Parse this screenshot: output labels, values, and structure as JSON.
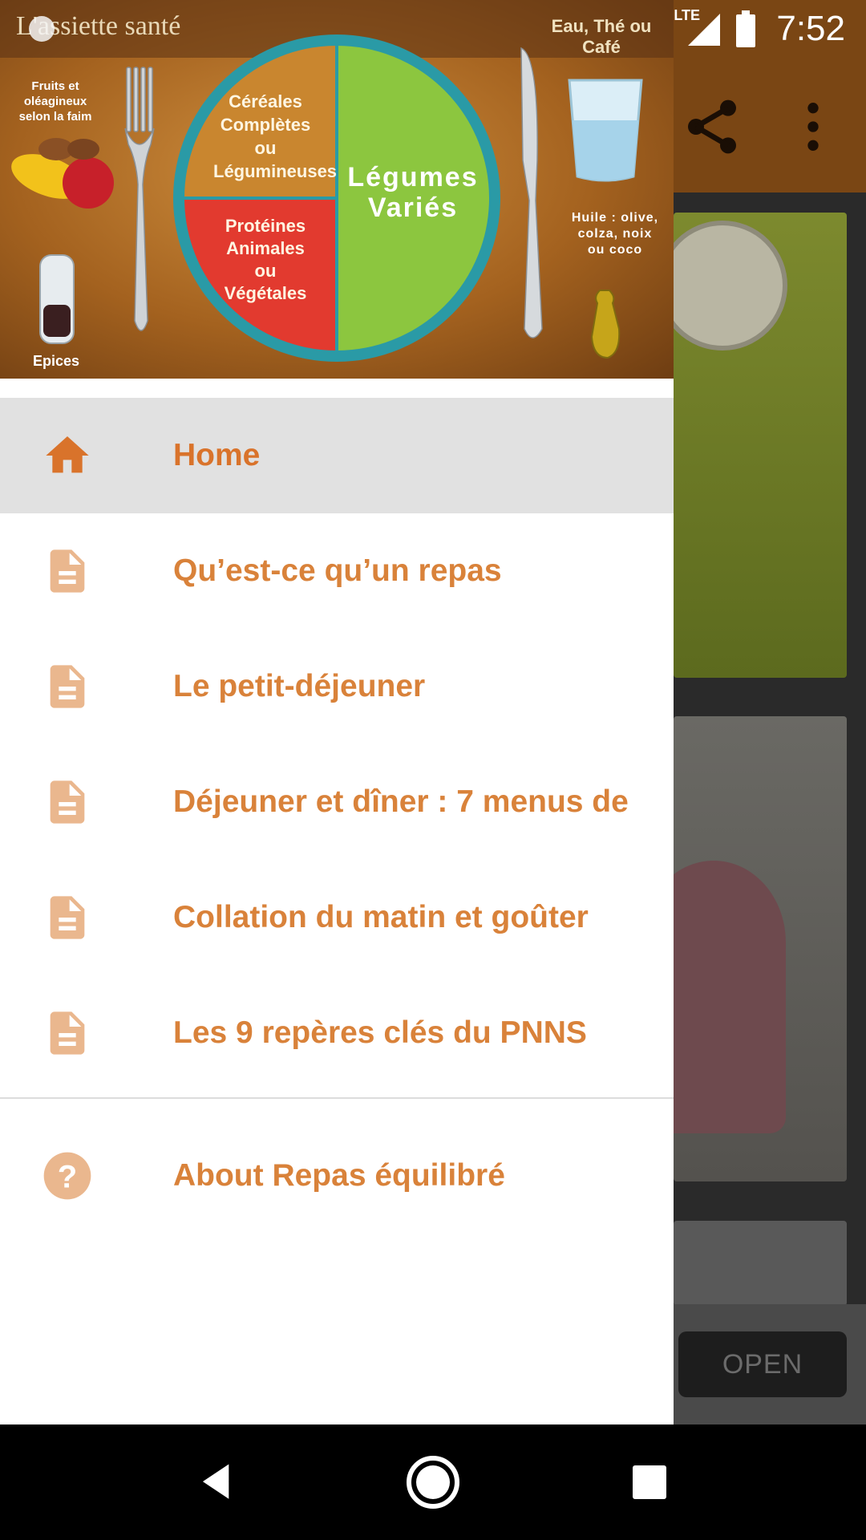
{
  "status_bar": {
    "network": "LTE",
    "time": "7:52"
  },
  "header": {
    "title": "L'assiette santé",
    "corner_note": "Eau, Thé ou Café",
    "left_note": "Fruits et oléagineux selon la faim",
    "right_note": "Huile : olive, colza, noix ou coco",
    "bottom_note": "Epices",
    "plate": {
      "cereals": "Céréales Complètes ou Légumineuses",
      "proteins": "Protéines Animales ou Végétales",
      "vegetables": "Légumes Variés"
    }
  },
  "menu": {
    "items": [
      {
        "label": "Home",
        "icon": "home-icon",
        "selected": true
      },
      {
        "label": "Qu’est-ce qu’un repas",
        "icon": "document-icon"
      },
      {
        "label": "Le petit-déjeuner",
        "icon": "document-icon"
      },
      {
        "label": "Déjeuner et dîner : 7 menus de",
        "icon": "document-icon"
      },
      {
        "label": "Collation du matin et goûter",
        "icon": "document-icon"
      },
      {
        "label": "Les 9 repères clés du PNNS",
        "icon": "document-icon"
      }
    ],
    "about": {
      "label": "About Repas équilibré",
      "icon": "help-icon"
    }
  },
  "background": {
    "open_button": "OPEN"
  },
  "colors": {
    "accent": "#d9823a",
    "toolbar": "#7a4614",
    "selected_bg": "#e1e1e1"
  }
}
